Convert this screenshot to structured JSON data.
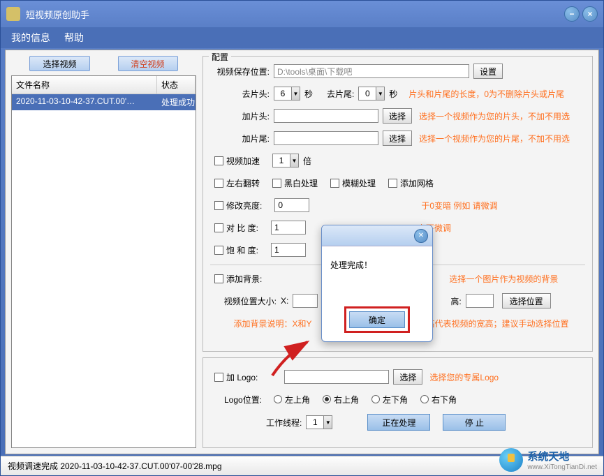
{
  "title": "短视频原创助手",
  "menu": {
    "myinfo": "我的信息",
    "help": "帮助"
  },
  "left": {
    "select_video": "选择视频",
    "clear_video": "清空视频",
    "col_name": "文件名称",
    "col_status": "状态",
    "file_name": "2020-11-03-10-42-37.CUT.00'…",
    "file_status": "处理成功"
  },
  "config": {
    "title": "配置",
    "save_label": "视频保存位置:",
    "save_path": "D:\\tools\\桌面\\下载吧",
    "set_btn": "设置",
    "trim_head_label": "去片头:",
    "trim_head_val": "6",
    "sec": "秒",
    "trim_tail_label": "去片尾:",
    "trim_tail_val": "0",
    "trim_hint": "片头和片尾的长度，0为不删除片头或片尾",
    "add_head_label": "加片头:",
    "select_btn": "选择",
    "add_head_hint": "选择一个视频作为您的片头，不加不用选",
    "add_tail_label": "加片尾:",
    "add_tail_hint": "选择一个视频作为您的片尾，不加不用选",
    "speed_label": "视频加速",
    "speed_val": "1",
    "speed_unit": "倍",
    "flip_label": "左右翻转",
    "bw_label": "黑白处理",
    "blur_label": "模糊处理",
    "grid_label": "添加网格",
    "bright_label": "修改亮度:",
    "bright_val": "0",
    "bright_hint_partial": "于0变暗  例如 请微调",
    "contrast_label": "对 比  度:",
    "contrast_val": "1",
    "contrast_hint_partial": "上下微调",
    "saturate_label": "饱 和  度:",
    "saturate_val": "1",
    "bg_label": "添加背景:",
    "bg_hint": "选择一个图片作为视频的背景",
    "pos_label": "视频位置大小:",
    "x_label": "X:",
    "h_label": "高:",
    "pos_btn": "选择位置",
    "bg_note_partial1": "添加背景说明：X和Y",
    "bg_note_partial2": "宽和高代表视频的宽高；建议手动选择位置"
  },
  "logo": {
    "add_logo_label": "加 Logo:",
    "select_btn": "选择",
    "logo_hint": "选择您的专属Logo",
    "pos_label": "Logo位置:",
    "tl": "左上角",
    "tr": "右上角",
    "bl": "左下角",
    "br": "右下角",
    "threads_label": "工作线程:",
    "threads_val": "1",
    "process_btn": "正在处理",
    "stop_btn": "停    止"
  },
  "dialog": {
    "message": "处理完成！",
    "ok": "确定"
  },
  "status": "视频调速完成 2020-11-03-10-42-37.CUT.00'07-00'28.mpg",
  "watermark": {
    "name": "系统天地",
    "url": "www.XiTongTianDi.net"
  }
}
